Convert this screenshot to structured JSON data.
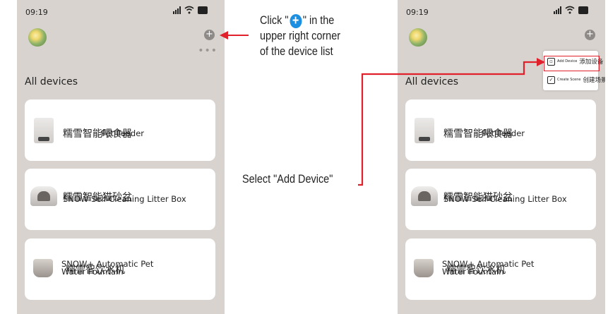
{
  "left_phone": {
    "status_time": "09:19",
    "section_title": "All devices",
    "more_dots": "•••",
    "plus_symbol": "+",
    "devices": [
      {
        "name_cn": "糯雪智能喂食器",
        "name_en": "Pet Feeder"
      },
      {
        "name_cn": "糯雪智能猫砂盆",
        "name_en": "SNOW Self-Cleaning Litter Box"
      },
      {
        "name_cn": "糯雪智饮水机",
        "name_en": "SNOW+ Automatic Pet Water Fountain"
      }
    ]
  },
  "right_phone": {
    "status_time": "09:19",
    "section_title": "All devices",
    "plus_symbol": "+",
    "popup": {
      "add_device_cn": "添加设备",
      "add_device_en": "Add Device",
      "create_scene_cn": "创建场景",
      "create_scene_en": "Create Scene"
    },
    "devices": [
      {
        "name_cn": "糯雪智能喂食器",
        "name_en": "Pet Feeder"
      },
      {
        "name_cn": "糯雪智能猫砂盆",
        "name_en": "SNOW Self-Cleaning Litter Box"
      },
      {
        "name_cn": "糯雪智饮水机",
        "name_en": "SNOW+ Automatic Pet Water Fountain"
      }
    ]
  },
  "annotations": {
    "step1_before": "Click \"",
    "step1_after": "\" in the",
    "step1_line2": "upper right corner",
    "step1_line3": "of the device list",
    "step2": "Select \"Add Device\"",
    "arrow_color": "#e0202a",
    "accent_color": "#1c8fe0"
  }
}
